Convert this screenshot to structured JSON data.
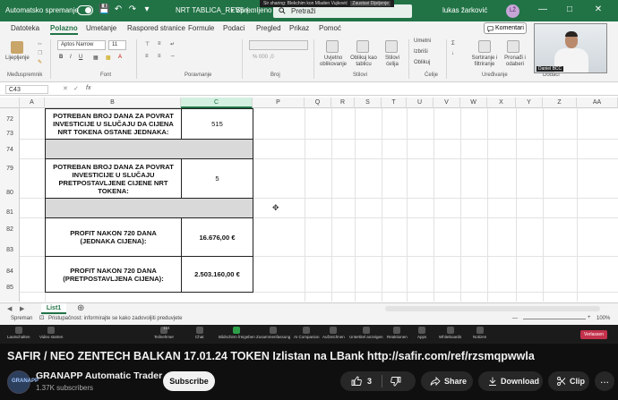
{
  "excel": {
    "titlebar": {
      "autosave_label": "Automatsko spremanje",
      "file_name": "NRT TABLICA_REV5 (...",
      "saved_status": "• Spremljeno",
      "search_placeholder": "Pretraži",
      "user_name": "lukas žarković",
      "user_initials": "LŽ",
      "notification_text": "Sir sharing: Blekchim kon Mladen Vujković",
      "notification_button": "Zaustavi Dijeljenje"
    },
    "tabs": [
      "Datoteka",
      "Polazno",
      "Umetanje",
      "Raspored stranice",
      "Formule",
      "Podaci",
      "Pregled",
      "Prikaz",
      "Pomoć"
    ],
    "active_tab": "Polazno",
    "comments_button": "Komentari",
    "ribbon": {
      "paste_label": "Lijepljenje",
      "font_name": "Aptos Narrow",
      "font_size": "11",
      "bold": "B",
      "italic": "I",
      "underline": "U",
      "cond_format": "Uvjetno oblikovanje",
      "format_table": "Oblikuj kao tablicu",
      "cell_styles": "Stilovi ćelija",
      "insert": "Umetni",
      "delete": "Izbriši",
      "format": "Oblikuj",
      "sort": "Sortiranje i filtriranje",
      "find": "Pronađi i odaberi",
      "groups": [
        "Međuspremnik",
        "Font",
        "Poravnanje",
        "Broj",
        "Stilovi",
        "Ćelije",
        "Uređivanje",
        "Dodaci"
      ]
    },
    "webcam_name": "Daniel BCC",
    "formula_bar": {
      "cell_ref": "C43",
      "fx": "fx"
    },
    "columns": [
      "A",
      "B",
      "C",
      "P",
      "Q",
      "R",
      "S",
      "T",
      "U",
      "V",
      "W",
      "X",
      "Y",
      "Z",
      "AA"
    ],
    "selected_column": "C",
    "rows": [
      "72",
      "73",
      "74",
      "79",
      "80",
      "81",
      "82",
      "83",
      "84",
      "85"
    ],
    "table": {
      "row1_label": "POTREBAN BROJ DANA ZA POVRAT INVESTICIJE U SLUČAJU DA CIJENA NRT TOKENA OSTANE JEDNAKA:",
      "row1_value": "515",
      "row2_label": "POTREBAN BROJ DANA ZA POVRAT INVESTICIJE U SLUČAJU PRETPOSTAVLJENE CIJENE NRT TOKENA:",
      "row2_value": "5",
      "row3_label": "PROFIT NAKON 720 DANA (JEDNAKA CIJENA):",
      "row3_value": "16.676,00 €",
      "row4_label": "PROFIT NAKON 720 DANA (PRETPOSTAVLJENA CIJENA):",
      "row4_value": "2.503.160,00 €"
    },
    "sheet_tab": "List1",
    "status": {
      "mode": "Spreman",
      "accessibility": "Pristupačnost: informirajte se kako zadovoljiti preduvjete",
      "zoom": "100%"
    },
    "meeting_toolbar": [
      "Lautschalten",
      "Video starten",
      "Teilnehmer",
      "Chat",
      "Bildschirm freigeben",
      "Zusammenfassung",
      "AI Companion",
      "Aufzeichnen",
      "Untertitel anzeigen",
      "Reaktionen",
      "Apps",
      "Whiteboards",
      "Notizen"
    ],
    "participants_count": "124",
    "leave_button": "Verlassen"
  },
  "youtube": {
    "video_title": "SAFIR / NEO ZENTECH BALKAN 17.01.24 TOKEN Izlistan na LBank http://safir.com/ref/rzsmqpwwla",
    "channel_name": "GRANAPP Automatic Trader",
    "channel_avatar_text": "GRANAPP",
    "subscribers": "1.37K subscribers",
    "subscribe_label": "Subscribe",
    "likes": "3",
    "share_label": "Share",
    "download_label": "Download",
    "clip_label": "Clip",
    "more_label": "..."
  },
  "colors": {
    "excel_green": "#217346",
    "yt_bg": "#0f0f0f",
    "pill_bg": "#272727"
  }
}
